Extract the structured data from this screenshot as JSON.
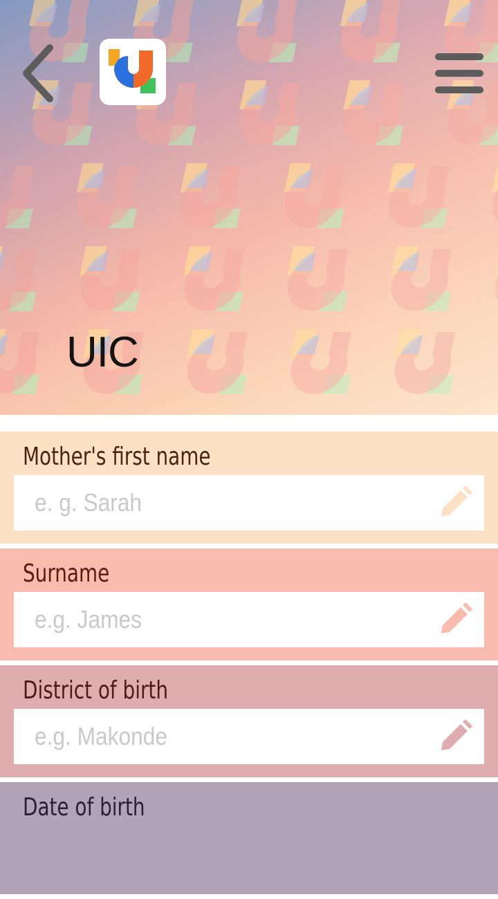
{
  "header": {
    "title": "UIC",
    "back_icon": "chevron-left-icon",
    "menu_icon": "hamburger-menu-icon",
    "logo_icon": "app-logo-icon"
  },
  "colors": {
    "field_1_bg": "#fde1c4",
    "field_2_bg": "#f8bbad",
    "field_3_bg": "#dfadaf",
    "field_4_bg": "#b3a3b8",
    "logo_blue": "#2b6fdc",
    "logo_orange": "#f26a2a",
    "logo_green": "#3fc35c"
  },
  "form": {
    "fields": [
      {
        "label": "Mother's first name",
        "placeholder": "e. g. Sarah",
        "icon": "pencil-icon"
      },
      {
        "label": "Surname",
        "placeholder": "e.g. James",
        "icon": "pencil-icon"
      },
      {
        "label": "District of birth",
        "placeholder": "e.g. Makonde",
        "icon": "pencil-icon"
      },
      {
        "label": "Date of birth"
      }
    ]
  }
}
